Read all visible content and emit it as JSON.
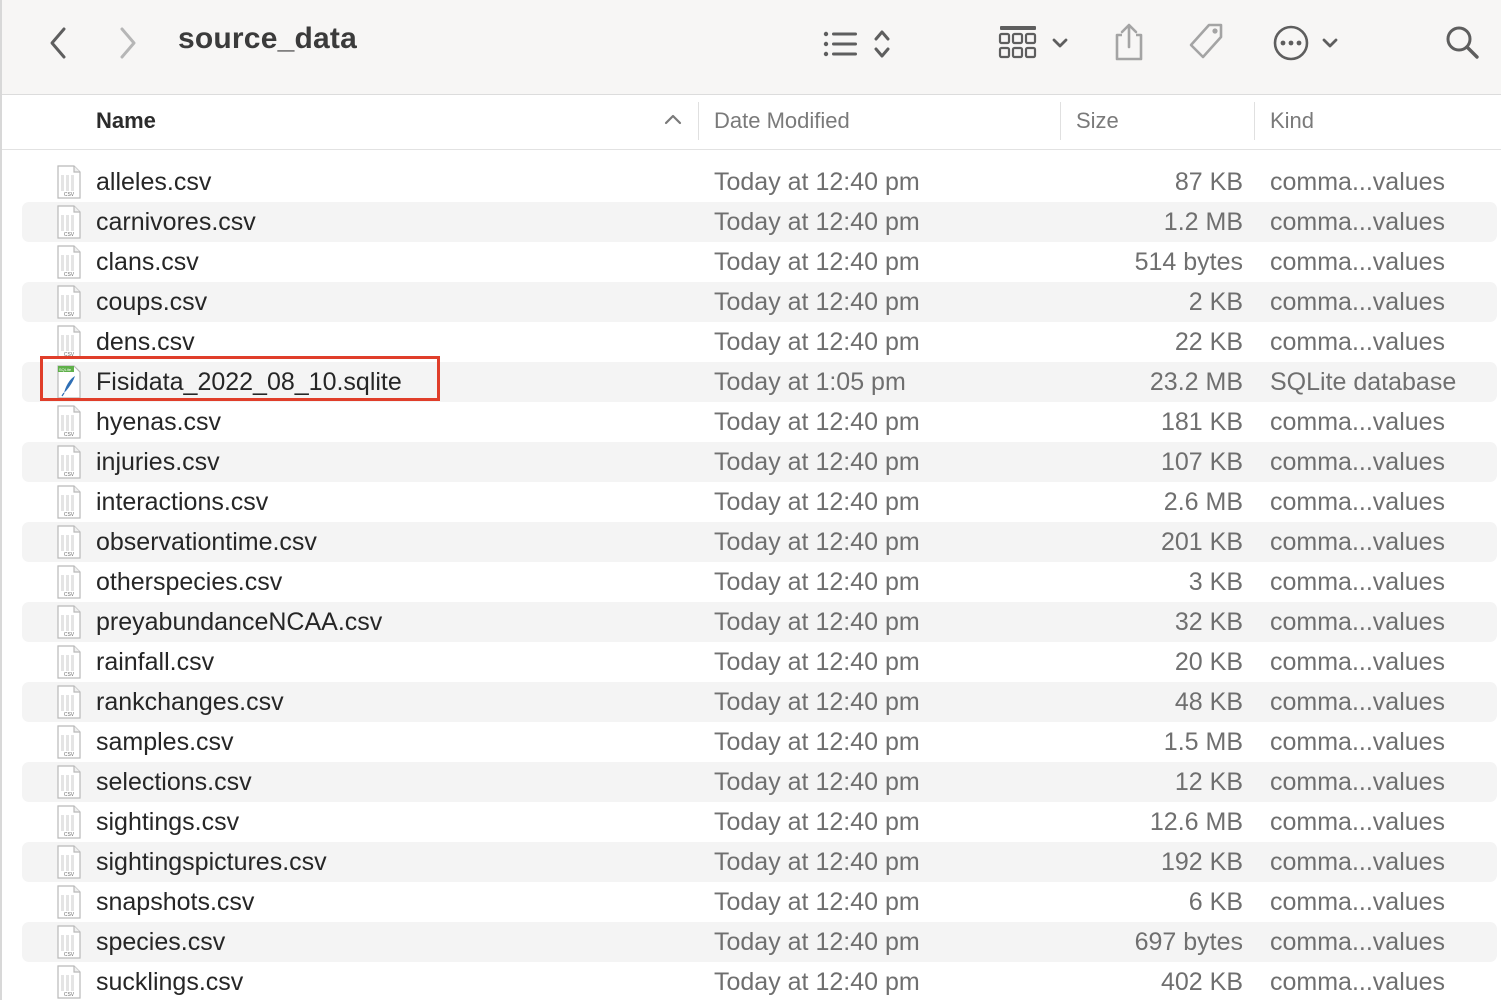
{
  "window": {
    "title": "source_data"
  },
  "toolbar": {
    "back_icon": "chevron-left-icon",
    "forward_icon": "chevron-right-icon",
    "list_view_icon": "list-view-icon",
    "group_icon": "grid-group-icon",
    "share_icon": "share-icon",
    "tag_icon": "tag-icon",
    "more_icon": "ellipsis-circle-icon",
    "search_icon": "search-icon"
  },
  "columns": {
    "name": "Name",
    "date": "Date Modified",
    "size": "Size",
    "kind": "Kind"
  },
  "files": [
    {
      "name": "alleles.csv",
      "date": "Today at 12:40 pm",
      "size": "87 KB",
      "kind": "comma...values",
      "type": "csv"
    },
    {
      "name": "carnivores.csv",
      "date": "Today at 12:40 pm",
      "size": "1.2 MB",
      "kind": "comma...values",
      "type": "csv"
    },
    {
      "name": "clans.csv",
      "date": "Today at 12:40 pm",
      "size": "514 bytes",
      "kind": "comma...values",
      "type": "csv"
    },
    {
      "name": "coups.csv",
      "date": "Today at 12:40 pm",
      "size": "2 KB",
      "kind": "comma...values",
      "type": "csv"
    },
    {
      "name": "dens.csv",
      "date": "Today at 12:40 pm",
      "size": "22 KB",
      "kind": "comma...values",
      "type": "csv"
    },
    {
      "name": "Fisidata_2022_08_10.sqlite",
      "date": "Today at 1:05 pm",
      "size": "23.2 MB",
      "kind": "SQLite database",
      "type": "sqlite",
      "highlighted": true
    },
    {
      "name": "hyenas.csv",
      "date": "Today at 12:40 pm",
      "size": "181 KB",
      "kind": "comma...values",
      "type": "csv"
    },
    {
      "name": "injuries.csv",
      "date": "Today at 12:40 pm",
      "size": "107 KB",
      "kind": "comma...values",
      "type": "csv"
    },
    {
      "name": "interactions.csv",
      "date": "Today at 12:40 pm",
      "size": "2.6 MB",
      "kind": "comma...values",
      "type": "csv"
    },
    {
      "name": "observationtime.csv",
      "date": "Today at 12:40 pm",
      "size": "201 KB",
      "kind": "comma...values",
      "type": "csv"
    },
    {
      "name": "otherspecies.csv",
      "date": "Today at 12:40 pm",
      "size": "3 KB",
      "kind": "comma...values",
      "type": "csv"
    },
    {
      "name": "preyabundanceNCAA.csv",
      "date": "Today at 12:40 pm",
      "size": "32 KB",
      "kind": "comma...values",
      "type": "csv"
    },
    {
      "name": "rainfall.csv",
      "date": "Today at 12:40 pm",
      "size": "20 KB",
      "kind": "comma...values",
      "type": "csv"
    },
    {
      "name": "rankchanges.csv",
      "date": "Today at 12:40 pm",
      "size": "48 KB",
      "kind": "comma...values",
      "type": "csv"
    },
    {
      "name": "samples.csv",
      "date": "Today at 12:40 pm",
      "size": "1.5 MB",
      "kind": "comma...values",
      "type": "csv"
    },
    {
      "name": "selections.csv",
      "date": "Today at 12:40 pm",
      "size": "12 KB",
      "kind": "comma...values",
      "type": "csv"
    },
    {
      "name": "sightings.csv",
      "date": "Today at 12:40 pm",
      "size": "12.6 MB",
      "kind": "comma...values",
      "type": "csv"
    },
    {
      "name": "sightingspictures.csv",
      "date": "Today at 12:40 pm",
      "size": "192 KB",
      "kind": "comma...values",
      "type": "csv"
    },
    {
      "name": "snapshots.csv",
      "date": "Today at 12:40 pm",
      "size": "6 KB",
      "kind": "comma...values",
      "type": "csv"
    },
    {
      "name": "species.csv",
      "date": "Today at 12:40 pm",
      "size": "697 bytes",
      "kind": "comma...values",
      "type": "csv"
    },
    {
      "name": "sucklings.csv",
      "date": "Today at 12:40 pm",
      "size": "402 KB",
      "kind": "comma...values",
      "type": "csv"
    }
  ],
  "file_icon_labels": {
    "csv": "CSV",
    "sqlite": "SQLite"
  },
  "colors": {
    "highlight_border": "#e03e2a",
    "alt_row": "#f4f4f4",
    "toolbar_bg": "#f7f6f5"
  }
}
